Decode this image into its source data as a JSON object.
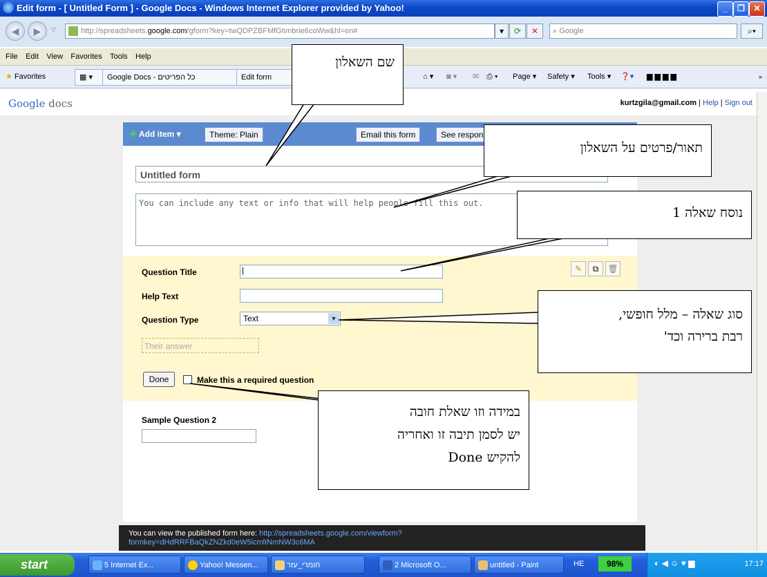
{
  "window": {
    "title": "Edit form - [ Untitled Form ] - Google Docs - Windows Internet Explorer provided by Yahoo!"
  },
  "address": {
    "url_prefix": "http://spreadsheets.",
    "url_domain": "google.com",
    "url_rest": "/gform?key=twQDPZBFMfGtvnbrie6coWw&hl=en#",
    "search_placeholder": "Google"
  },
  "menu": [
    "File",
    "Edit",
    "View",
    "Favorites",
    "Tools",
    "Help"
  ],
  "favorites": {
    "label": "Favorites",
    "tab1": "Google Docs - כל הפריטים",
    "tab2": "Edit form",
    "tools": [
      "Page ▾",
      "Safety ▾",
      "Tools ▾"
    ]
  },
  "docs_header": {
    "logo_google": "Google",
    "logo_docs": "docs",
    "email": "kurtzgila@gmail.com",
    "help": "Help",
    "signout": "Sign out",
    "sep": "|"
  },
  "toolbar": {
    "add_item": "Add item",
    "theme": "Theme: Plain",
    "email_form": "Email this form",
    "see_responses": "See responses"
  },
  "form": {
    "title": "Untitled form",
    "description": "You can include any text or info that will help people fill this out."
  },
  "question": {
    "title_label": "Question Title",
    "help_label": "Help Text",
    "type_label": "Question Type",
    "type_value": "Text",
    "answer_placeholder": "Their answer",
    "done": "Done",
    "required_label": "Make this a required question"
  },
  "sample_question": {
    "label": "Sample Question 2"
  },
  "published": {
    "prefix": "You can view the published form here:",
    "link_part1": "http://spreadsheets.google.com/viewform?",
    "link_part2": "formkey=dHdRRFBaQkZNZkd0eW5icmlINmNW3c6MA"
  },
  "callouts": {
    "form_name": "שם השאלון",
    "form_description": "תאור/פרטים על השאלון",
    "question_text": "נוסח שאלה 1",
    "question_type_line1": "סוג שאלה – מלל חופשי,",
    "question_type_line2": "רבת ברירה וכד'",
    "required_line1": "במידה וזו שאלת חובה",
    "required_line2": "יש לסמן תיבה זו ואחריה",
    "required_line3": "להקיש  Done"
  },
  "taskbar": {
    "start": "start",
    "tasks": [
      "5 Internet Ex...",
      "Yahoo! Messen...",
      "חומרי_עזר",
      "2 Microsoft O...",
      "untitled - Paint"
    ],
    "lang": "HE",
    "battery": "98%",
    "time": "17:17"
  }
}
